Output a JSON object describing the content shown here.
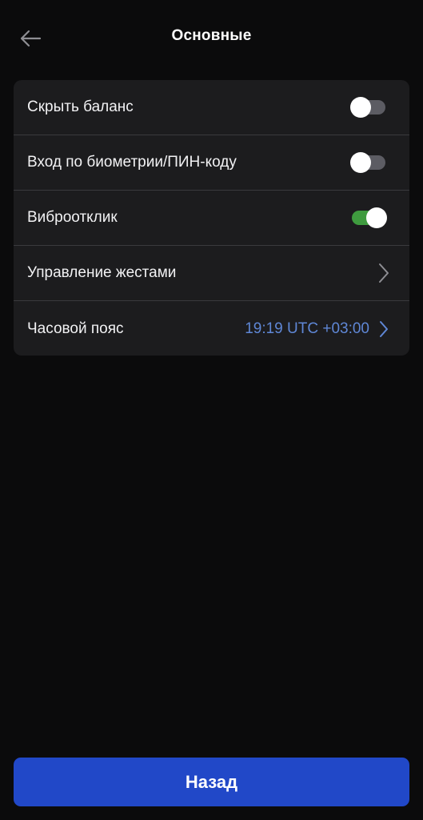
{
  "header": {
    "title": "Основные",
    "back_icon": "arrow-left-icon"
  },
  "settings": {
    "items": [
      {
        "label": "Скрыть баланс",
        "type": "toggle",
        "on": false
      },
      {
        "label": "Вход по биометрии/ПИН-коду",
        "type": "toggle",
        "on": false
      },
      {
        "label": "Виброотклик",
        "type": "toggle",
        "on": true
      },
      {
        "label": "Управление жестами",
        "type": "link",
        "icon": "chevron-right-icon"
      },
      {
        "label": "Часовой пояс",
        "type": "link",
        "value": "19:19 UTC +03:00",
        "icon": "chevron-right-icon"
      }
    ]
  },
  "footer": {
    "button_label": "Назад"
  },
  "colors": {
    "background": "#0b0b0c",
    "card": "#1c1c1e",
    "accent": "#2148c8",
    "toggle_on": "#3f9b3f",
    "toggle_off": "#5c5c63",
    "value_text": "#5f87d6"
  }
}
